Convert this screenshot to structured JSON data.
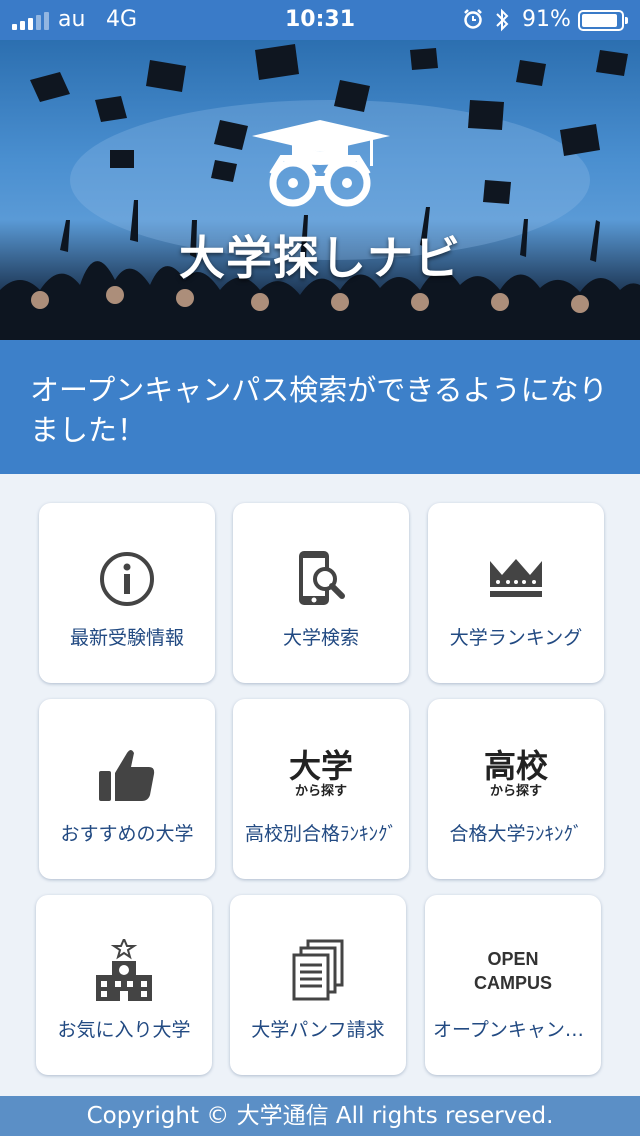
{
  "status_bar": {
    "carrier": "au",
    "network": "4G",
    "time": "10:31",
    "battery_percent": "91%",
    "battery_level": 0.91
  },
  "hero": {
    "app_name": "大学探しナビ"
  },
  "banner": {
    "message": "オープンキャンパス検索ができるようになりました！"
  },
  "menu": [
    {
      "label": "最新受験情報",
      "icon": "info-icon"
    },
    {
      "label": "大学検索",
      "icon": "phone-search-icon"
    },
    {
      "label": "大学ランキング",
      "icon": "crown-icon"
    },
    {
      "label": "おすすめの大学",
      "icon": "thumbs-up-icon"
    },
    {
      "label": "高校別合格ﾗﾝｷﾝｸﾞ",
      "icon": "text-icon",
      "icon_main": "大学",
      "icon_sub": "から探す"
    },
    {
      "label": "合格大学ﾗﾝｷﾝｸﾞ",
      "icon": "text-icon",
      "icon_main": "高校",
      "icon_sub": "から探す"
    },
    {
      "label": "お気に入り大学",
      "icon": "school-building-icon"
    },
    {
      "label": "大学パンフ請求",
      "icon": "documents-icon"
    },
    {
      "label": "オープンキャンパス",
      "icon": "text-icon",
      "icon_line1": "OPEN",
      "icon_line2": "CAMPUS"
    }
  ],
  "footer": {
    "copyright": "Copyright © 大学通信 All rights reserved."
  },
  "colors": {
    "status_bar": "#3a7bc8",
    "banner": "#3d80c9",
    "label_text": "#224a82",
    "footer": "#5b8fc6",
    "background": "#edf2f8"
  }
}
